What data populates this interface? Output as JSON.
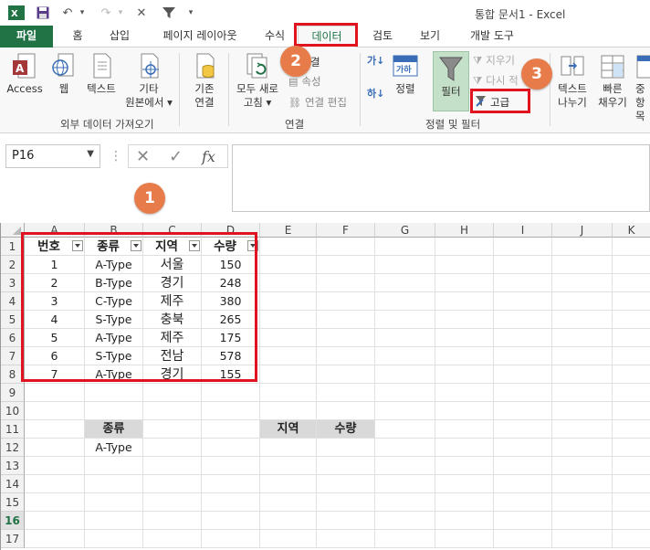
{
  "window": {
    "title": "통합 문서1 - Excel"
  },
  "tabs": [
    "파일",
    "홈",
    "삽입",
    "페이지 레이아웃",
    "수식",
    "데이터",
    "검토",
    "보기",
    "개발 도구"
  ],
  "ribbon": {
    "external": {
      "access": "Access",
      "web": "웹",
      "text": "텍스트",
      "other_1": "기타",
      "other_2": "원본에서 ▾",
      "existing_1": "기존",
      "existing_2": "연결",
      "group": "외부 데이터 가져오기"
    },
    "connections": {
      "refresh_1": "모두 새로",
      "refresh_2": "고침 ▾",
      "connections": "결",
      "properties": "속성",
      "edit_links": "연결 편집",
      "group": "연결"
    },
    "sort_filter": {
      "sort": "정렬",
      "filter": "필터",
      "clear": "지우기",
      "reapply": "다시 적",
      "advanced": "고급",
      "group": "정렬 및 필터"
    },
    "tools": {
      "text_to_cols_1": "텍스트",
      "text_to_cols_2": "나누기",
      "flash_fill_1": "빠른",
      "flash_fill_2": "채우기",
      "remove_dup_1": "중",
      "remove_dup_2": "항목"
    }
  },
  "formula_bar": {
    "name_box": "P16",
    "fx": "fx"
  },
  "badges": [
    "1",
    "2",
    "3"
  ],
  "columns": [
    "A",
    "B",
    "C",
    "D",
    "E",
    "F",
    "G",
    "H",
    "I",
    "J",
    "K"
  ],
  "rows": [
    "1",
    "2",
    "3",
    "4",
    "5",
    "6",
    "7",
    "8",
    "9",
    "10",
    "11",
    "12",
    "13",
    "14",
    "15",
    "16",
    "17"
  ],
  "table": {
    "headers": [
      "번호",
      "종류",
      "지역",
      "수량"
    ],
    "rows": [
      [
        "1",
        "A-Type",
        "서울",
        "150"
      ],
      [
        "2",
        "B-Type",
        "경기",
        "248"
      ],
      [
        "3",
        "C-Type",
        "제주",
        "380"
      ],
      [
        "4",
        "S-Type",
        "충북",
        "265"
      ],
      [
        "5",
        "A-Type",
        "제주",
        "175"
      ],
      [
        "6",
        "S-Type",
        "전남",
        "578"
      ],
      [
        "7",
        "A-Type",
        "경기",
        "155"
      ]
    ]
  },
  "criteria": {
    "b11": "종류",
    "b12": "A-Type",
    "e11": "지역",
    "f11": "수량"
  },
  "colors": {
    "excel_green": "#217346",
    "highlight_red": "#e0141e",
    "badge_orange": "#e77c4a"
  }
}
